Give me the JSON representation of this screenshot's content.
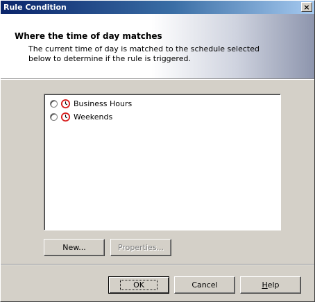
{
  "window": {
    "title": "Rule Condition",
    "close_symbol": "×"
  },
  "header": {
    "title": "Where the time of day matches",
    "description": "The current time of day is matched to the schedule selected below to determine if the rule is triggered."
  },
  "schedules": [
    {
      "label": "Business Hours",
      "selected": false,
      "icon": "clock-icon"
    },
    {
      "label": "Weekends",
      "selected": false,
      "icon": "clock-icon"
    }
  ],
  "list_buttons": {
    "new_label": "New...",
    "properties_label": "Properties..."
  },
  "footer": {
    "ok_label": "OK",
    "cancel_label": "Cancel",
    "help_label_mnemonic": "H",
    "help_label_rest": "elp"
  },
  "colors": {
    "title_bar": "#0a246a",
    "dialog_face": "#d4d0c8",
    "clock_face": "#d81e1e"
  }
}
